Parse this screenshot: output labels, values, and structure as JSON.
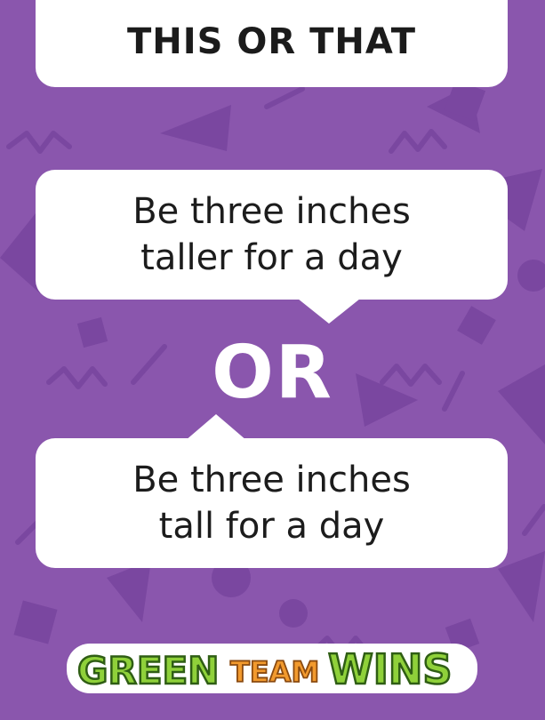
{
  "header": {
    "title": "THIS OR THAT"
  },
  "options": [
    {
      "text": "Be three inches\ntaller for a day"
    },
    {
      "text": "Be three inches\ntall for a day"
    }
  ],
  "divider": {
    "label": "OR"
  },
  "brand": {
    "green_word": "GREEN",
    "team_word": "TEAM",
    "wins_word": "WINS",
    "colors": {
      "green": "#8fd13a",
      "orange": "#f29a2e",
      "outline": "#2f5e14"
    }
  },
  "colors": {
    "background": "#8a56ad",
    "pattern": "#7a47a0",
    "card": "#ffffff",
    "text": "#1c1c1c"
  }
}
